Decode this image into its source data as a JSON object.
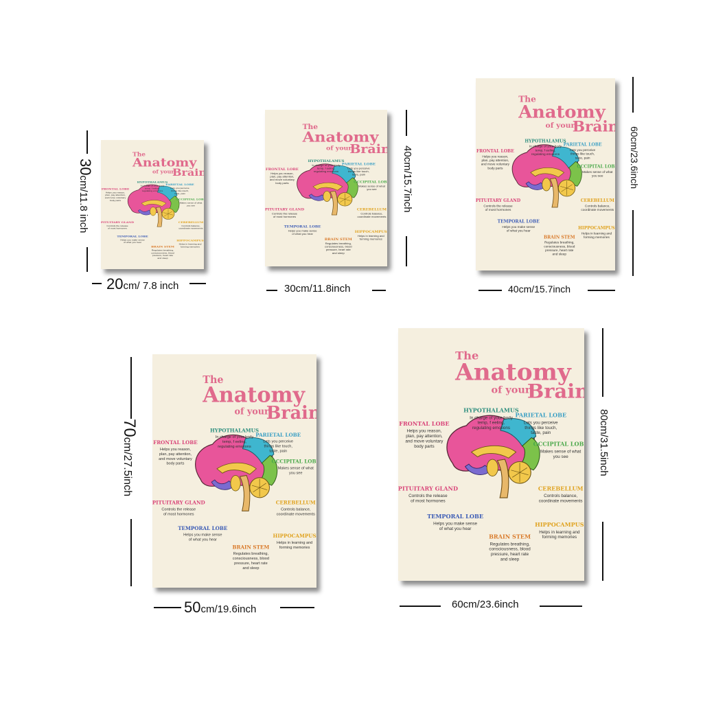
{
  "poster": {
    "title_line1": "The",
    "title_line2": "Anatomy",
    "title_line3": "of your",
    "title_line4": "Brain",
    "labels": [
      {
        "key": "hypothalamus",
        "head": "HYPOTHALAMUS",
        "body": "In charge of your body temp, f eeling, regulating emotions",
        "color": "#2f8f7f"
      },
      {
        "key": "parietal",
        "head": "PARIETAL LOBE",
        "body": "Lets you perceive things like touch, taste, pain",
        "color": "#3a9fc4"
      },
      {
        "key": "frontal",
        "head": "FRONTAL LOBE",
        "body": "Helps you reason, plan, pay attention, and move voluntary body parts",
        "color": "#d9467a"
      },
      {
        "key": "occipital",
        "head": "OCCIPITAL LOBE",
        "body": "Makes sense of what you see",
        "color": "#4aa84a"
      },
      {
        "key": "pituitary",
        "head": "PITUITARY GLAND",
        "body": "Controls the release of most hormones",
        "color": "#d9467a"
      },
      {
        "key": "cerebellum",
        "head": "CEREBELLUM",
        "body": "Controls balance, coordinate movements",
        "color": "#e0a321"
      },
      {
        "key": "temporal",
        "head": "TEMPORAL LOBE",
        "body": "Helps you make sense of what you hear",
        "color": "#3b5bb5"
      },
      {
        "key": "hippocampus",
        "head": "HIPPOCAMPUS",
        "body": "Helps in learning and forming memories",
        "color": "#e0a321"
      },
      {
        "key": "brainstem",
        "head": "BRAIN STEM",
        "body": "Regulates breathing, consciousness, blood pressure, heart rate and sleep",
        "color": "#d97a2a"
      }
    ],
    "colors": {
      "background": "#f5efdf",
      "title": "#e06a8c",
      "frontal": "#e8559a",
      "parietal": "#3fb6cf",
      "occipital": "#7cc24a",
      "cerebellum": "#f2c84b",
      "temporal": "#7a6bd0",
      "stem": "#e8b86a"
    }
  },
  "sizes": [
    {
      "w_num": "20",
      "w_text": "cm/ 7.8 inch",
      "h_num": "30",
      "h_text": "cm/11.8 inch"
    },
    {
      "w_text": "30cm/11.8inch",
      "h_text": "40cm/15.7inch"
    },
    {
      "w_text": "40cm/15.7inch",
      "h_text": "60cm/23.6inch"
    },
    {
      "w_num": "50",
      "w_text": "cm/19.6inch",
      "h_num": "70",
      "h_text": "cm/27.5inch"
    },
    {
      "w_text": "60cm/23.6inch",
      "h_text": "80cm/31.5inch"
    }
  ]
}
